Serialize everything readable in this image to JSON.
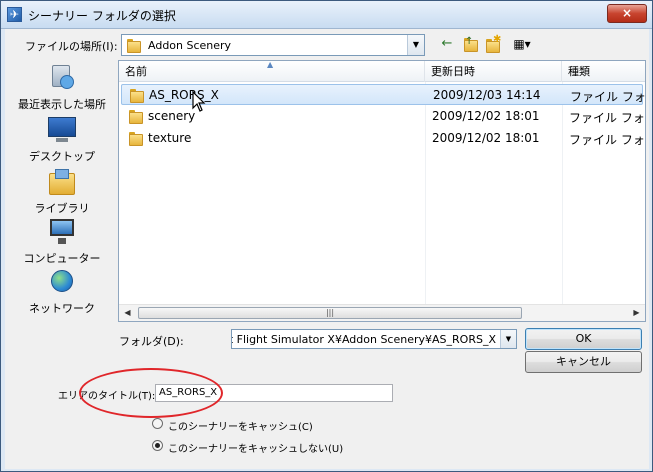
{
  "window": {
    "title": "シーナリー フォルダの選択",
    "close_label": "×"
  },
  "location": {
    "label": "ファイルの場所(I):",
    "value": "Addon Scenery"
  },
  "toolbar": {
    "back_icon": "←",
    "up_icon": "↑",
    "new_folder_icon": "✱",
    "view_icon": "▦▾"
  },
  "places": [
    {
      "label": "最近表示した場所",
      "icon": "recent-places-icon"
    },
    {
      "label": "デスクトップ",
      "icon": "desktop-icon"
    },
    {
      "label": "ライブラリ",
      "icon": "libraries-icon"
    },
    {
      "label": "コンピューター",
      "icon": "computer-icon"
    },
    {
      "label": "ネットワーク",
      "icon": "network-icon"
    }
  ],
  "file_list": {
    "columns": [
      "名前",
      "更新日時",
      "種類"
    ],
    "rows": [
      {
        "name": "AS_RORS_X",
        "modified": "2009/12/03 14:14",
        "type": "ファイル フォ",
        "selected": true
      },
      {
        "name": "scenery",
        "modified": "2009/12/02 18:01",
        "type": "ファイル フォ",
        "selected": false
      },
      {
        "name": "texture",
        "modified": "2009/12/02 18:01",
        "type": "ファイル フォ",
        "selected": false
      }
    ],
    "scroll_left": "◀",
    "scroll_right": "▶",
    "scroll_grip": "|||"
  },
  "folder": {
    "label": "フォルダ(D):",
    "value": "soft Flight Simulator X¥Addon Scenery¥AS_RORS_X"
  },
  "buttons": {
    "ok": "OK",
    "cancel": "キャンセル"
  },
  "area_title": {
    "label": "エリアのタイトル(T):",
    "value": "AS_RORS_X"
  },
  "cache_options": [
    {
      "label": "このシーナリーをキャッシュ(C)",
      "selected": false
    },
    {
      "label": "このシーナリーをキャッシュしない(U)",
      "selected": true
    }
  ],
  "colors": {
    "highlight_ellipse": "#e0262a",
    "selection": "#d3e6fa"
  }
}
